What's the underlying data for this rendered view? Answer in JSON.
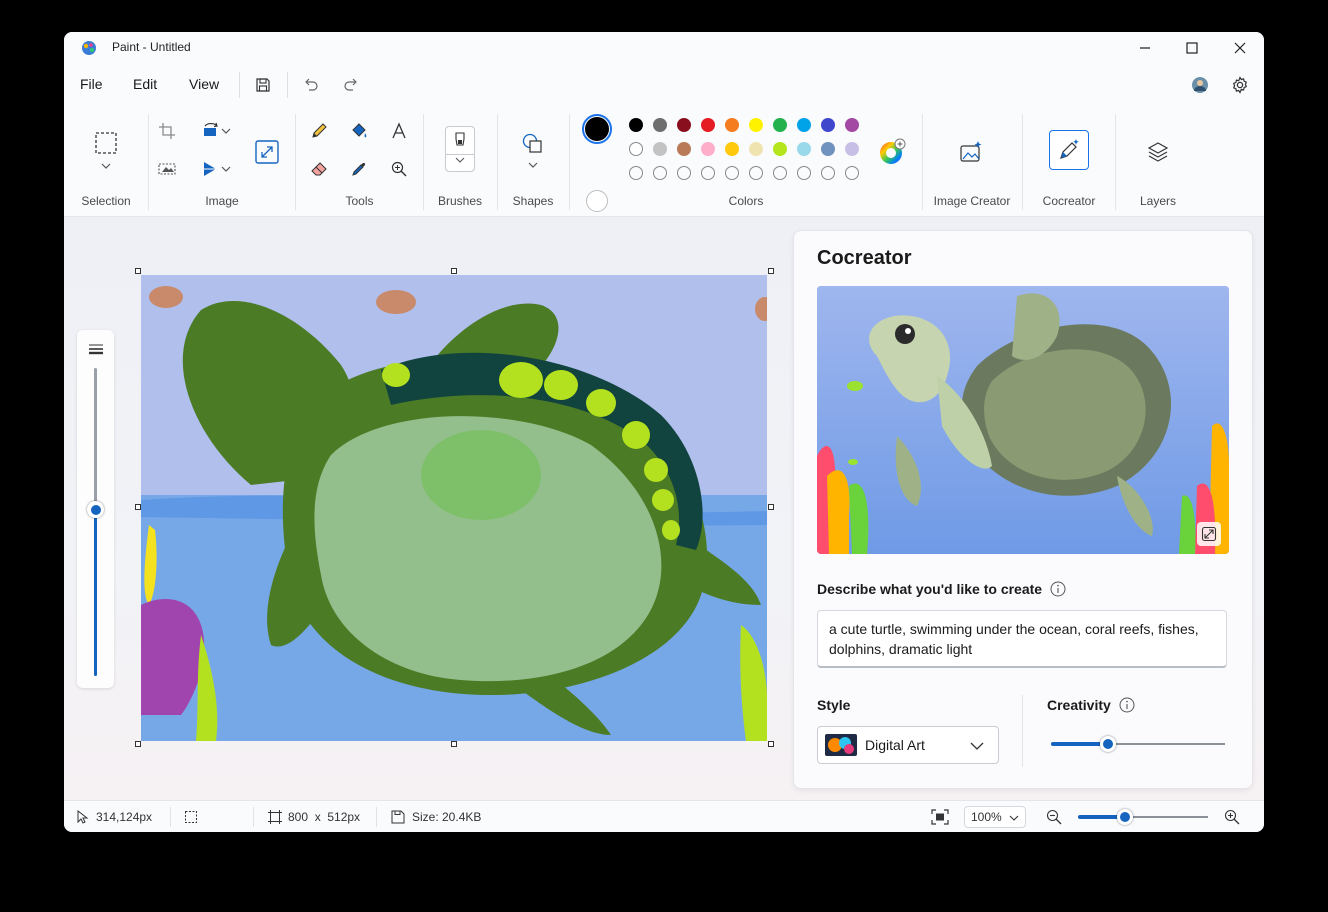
{
  "window": {
    "title": "Paint - Untitled"
  },
  "menu": {
    "file": "File",
    "edit": "Edit",
    "view": "View"
  },
  "ribbon": {
    "groups": {
      "selection": "Selection",
      "image": "Image",
      "tools": "Tools",
      "brushes": "Brushes",
      "shapes": "Shapes",
      "colors": "Colors",
      "image_creator": "Image Creator",
      "cocreator": "Cocreator",
      "layers": "Layers"
    },
    "primary_color": "#000000",
    "secondary_color": "#ffffff",
    "palette_row1": [
      "#000000",
      "#6e6e6e",
      "#8a0f1e",
      "#e51c23",
      "#f57c1f",
      "#fff200",
      "#22b14c",
      "#00a2e8",
      "#3f48cc",
      "#a349a4"
    ],
    "palette_row2": [
      "#ffffff",
      "#c3c3c3",
      "#b97a57",
      "#ffaec9",
      "#ffc90e",
      "#efe4b0",
      "#b5e61d",
      "#99d9ea",
      "#7092be",
      "#c8bfe7"
    ]
  },
  "cocreator": {
    "title": "Cocreator",
    "describe_label": "Describe what you'd like to create",
    "prompt": "a cute turtle, swimming under the ocean, coral reefs, fishes, dolphins, dramatic light",
    "style_label": "Style",
    "style_value": "Digital Art",
    "creativity_label": "Creativity",
    "creativity_level": 0.33
  },
  "brush_size_level": 0.54,
  "status": {
    "cursor": "314,124px",
    "canvas_size": "800  x  512px",
    "file_size": "Size: 20.4KB",
    "zoom": "100%",
    "zoom_level": 0.36
  }
}
